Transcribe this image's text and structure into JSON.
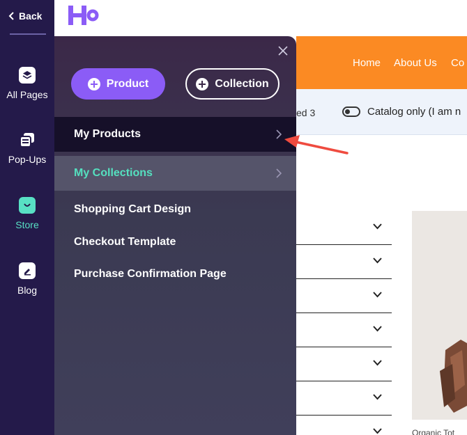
{
  "rail": {
    "back_label": "Back",
    "items": [
      {
        "label": "All Pages",
        "icon": "layers-icon"
      },
      {
        "label": "Pop-Ups",
        "icon": "popups-icon"
      },
      {
        "label": "Store",
        "icon": "shopping-bag-icon",
        "active": true
      },
      {
        "label": "Blog",
        "icon": "edit-icon"
      }
    ]
  },
  "page": {
    "nav_links": [
      "Home",
      "About Us",
      "Co"
    ],
    "info_bar_fragment": "ed 3",
    "catalog_toggle_label": "Catalog only (I am n",
    "product_caption": "Organic Tot"
  },
  "panel": {
    "product_button": "Product",
    "collection_button": "Collection",
    "rows": [
      {
        "label": "My Products"
      },
      {
        "label": "My Collections"
      }
    ],
    "items": [
      "Shopping Cart Design",
      "Checkout Template",
      "Purchase Confirmation Page"
    ]
  },
  "colors": {
    "rail_bg": "#241a4a",
    "accent_purple": "#8b5cf6",
    "accent_teal": "#55e0bf",
    "nav_orange": "#fb8a23",
    "annotation_red": "#ef4b3f"
  }
}
